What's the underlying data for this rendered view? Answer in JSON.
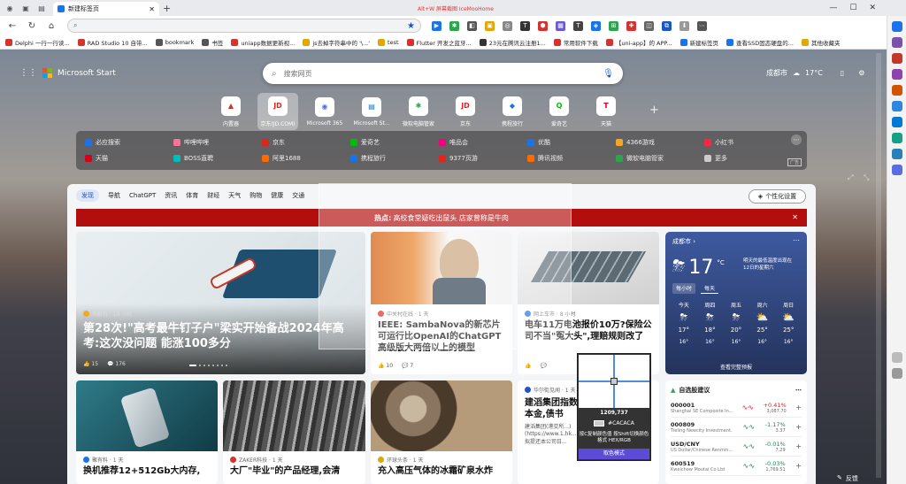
{
  "browser": {
    "tab_title": "新建标签页",
    "overlay_red_text": "Alt+W 屏幕截图 IceMooHome",
    "address_value": "",
    "address_placeholder": "",
    "bookmarks": [
      {
        "label": "Delphi 一行一行读...",
        "color": "#d4332f"
      },
      {
        "label": "RAD Studio 10 自带...",
        "color": "#d4332f"
      },
      {
        "label": "bookmark",
        "color": "#555"
      },
      {
        "label": "书签",
        "color": "#555"
      },
      {
        "label": "uniapp数据更新视...",
        "color": "#d4332f"
      },
      {
        "label": "js去掉字符串中的 '\\...'",
        "color": "#e0a800"
      },
      {
        "label": "test",
        "color": "#e0a800"
      },
      {
        "label": "Flutter 开发之蓝牙...",
        "color": "#d4332f"
      },
      {
        "label": "23元在腾讯云注册1...",
        "color": "#333"
      },
      {
        "label": "常用软件下载",
        "color": "#d4332f"
      },
      {
        "label": "【uni-app】的 APP...",
        "color": "#d4332f"
      },
      {
        "label": "新建标签页",
        "color": "#1a73e8"
      },
      {
        "label": "查看SSD固态硬盘的...",
        "color": "#1a73e8"
      },
      {
        "label": "其他收藏夹",
        "color": "#e0a800"
      }
    ]
  },
  "start": {
    "brand": "Microsoft Start",
    "search_placeholder": "搜索网页",
    "city": "成都市",
    "temp": "17",
    "temp_unit": "°C",
    "tiles": [
      {
        "label": "内置器",
        "glyph": "▲",
        "color": "#c0392b",
        "selected": false
      },
      {
        "label": "京东(JD.COM)",
        "glyph": "JD",
        "color": "#e1251b",
        "selected": true
      },
      {
        "label": "Microsoft 365",
        "glyph": "◉",
        "color": "#4f6bed",
        "selected": false
      },
      {
        "label": "Microsoft St...",
        "glyph": "▤",
        "color": "#0078d4",
        "selected": false
      },
      {
        "label": "微软电脑管家",
        "glyph": "✱",
        "color": "#2da44e",
        "selected": false
      },
      {
        "label": "京东",
        "glyph": "JD",
        "color": "#e1251b",
        "selected": false
      },
      {
        "label": "携程旅行",
        "glyph": "◆",
        "color": "#1a73e8",
        "selected": false
      },
      {
        "label": "爱奇艺",
        "glyph": "Q",
        "color": "#00be06",
        "selected": false
      },
      {
        "label": "天猫",
        "glyph": "T",
        "color": "#d4001d",
        "selected": false
      }
    ],
    "links_row1": [
      {
        "label": "必应搜索",
        "color": "#1a73e8"
      },
      {
        "label": "哔哩哔哩",
        "color": "#fb7299"
      },
      {
        "label": "京东",
        "color": "#e1251b"
      },
      {
        "label": "爱奇艺",
        "color": "#00be06"
      },
      {
        "label": "唯品会",
        "color": "#f10180"
      },
      {
        "label": "优酷",
        "color": "#1a73e8"
      },
      {
        "label": "4366游戏",
        "color": "#f5a623"
      },
      {
        "label": "小红书",
        "color": "#ff2442"
      }
    ],
    "links_row2": [
      {
        "label": "天猫",
        "color": "#d4001d"
      },
      {
        "label": "BOSS直聘",
        "color": "#00bebd"
      },
      {
        "label": "阿里1688",
        "color": "#ff6a00"
      },
      {
        "label": "携程旅行",
        "color": "#1a73e8"
      },
      {
        "label": "9377页游",
        "color": "#e1251b"
      },
      {
        "label": "腾讯视频",
        "color": "#ff6a00"
      },
      {
        "label": "微软电脑管家",
        "color": "#2da44e"
      },
      {
        "label": "更多",
        "color": "#ccc"
      }
    ],
    "ad_label": "广告"
  },
  "feed": {
    "tabs": [
      "发现",
      "导航",
      "ChatGPT",
      "资讯",
      "体育",
      "财经",
      "天气",
      "购物",
      "健康",
      "交通"
    ],
    "personalize": "个性化设置",
    "hot_label": "热点:",
    "hot_text": "高校食堂疑吃出鼠头 店家曾称是牛肉",
    "hero": {
      "source": "快解析 · 10 小时",
      "title": "第28次!\"高考最牛钉子户\"梁实开始备战2024年高考:这次没问题 能涨100多分",
      "likes": "15",
      "comments": "176"
    },
    "card2": {
      "source": "中关村在线 · 1 天",
      "title": "IEEE: SambaNova的新芯片可运行比OpenAI的ChatGPT高级版大两倍以上的模型",
      "likes": "10",
      "comments": "7"
    },
    "card3": {
      "source": "网上车市 · 8 小时",
      "title": "电车11万电池报价10万?保险公司不当\"冤大头\",理赔规则改了"
    },
    "card4": {
      "source": "华尔街见闻 · 1 天",
      "title": "建滔集团指数元贷款本金,债书",
      "snippet": "建滔集团(港交所...)(https://www.1.hk...),拟提还本公司日..."
    },
    "bottom1": {
      "source": "聚有料 · 1 天",
      "title": "换机推荐12+512Gb大内存,"
    },
    "bottom2": {
      "source": "ZAKER科技 · 1 天",
      "title": "大厂\"毕业\"的产品经理,会清"
    },
    "bottom3": {
      "source": "环球头条 · 1 天",
      "title": "充入高压气体的冰霜矿泉水炸"
    }
  },
  "weather": {
    "city": "成都市",
    "temp": "17",
    "unit": "°C",
    "desc": "明天的最低温度出现在12日的星期六",
    "tab_hourly": "每小时",
    "tab_daily": "每天",
    "days": [
      {
        "d": "今天",
        "hi": "17°",
        "lo": "16°"
      },
      {
        "d": "周四",
        "hi": "18°",
        "lo": "16°"
      },
      {
        "d": "周五",
        "hi": "20°",
        "lo": "16°"
      },
      {
        "d": "周六",
        "hi": "25°",
        "lo": "16°"
      },
      {
        "d": "周日",
        "hi": "25°",
        "lo": "16°"
      }
    ],
    "more": "查看完整预报"
  },
  "stocks": {
    "title": "自选股建议",
    "rows": [
      {
        "code": "000001",
        "name": "Shanghai SE Composite In...",
        "pct": "+0.41%",
        "val": "3,087.70",
        "cls": "pos"
      },
      {
        "code": "000809",
        "name": "Tieling Newcity Investment...",
        "pct": "-1.17%",
        "val": "3.37",
        "cls": "grn"
      },
      {
        "code": "USD/CNY",
        "name": "US Dollar/Chinese Renmin...",
        "pct": "-0.01%",
        "val": "7.29",
        "cls": "grn"
      },
      {
        "code": "600519",
        "name": "Kweichow Moutai Co Ltd",
        "pct": "-0.03%",
        "val": "1,769.51",
        "cls": "grn"
      }
    ]
  },
  "picker": {
    "coord": "1209,737",
    "color": "#CACACA",
    "hint": "按C复制颜色值 按Shift切换颜色格式 HEX/RGB",
    "mode": "取色模式"
  },
  "bottom_bar": {
    "feedback": "反馈"
  }
}
